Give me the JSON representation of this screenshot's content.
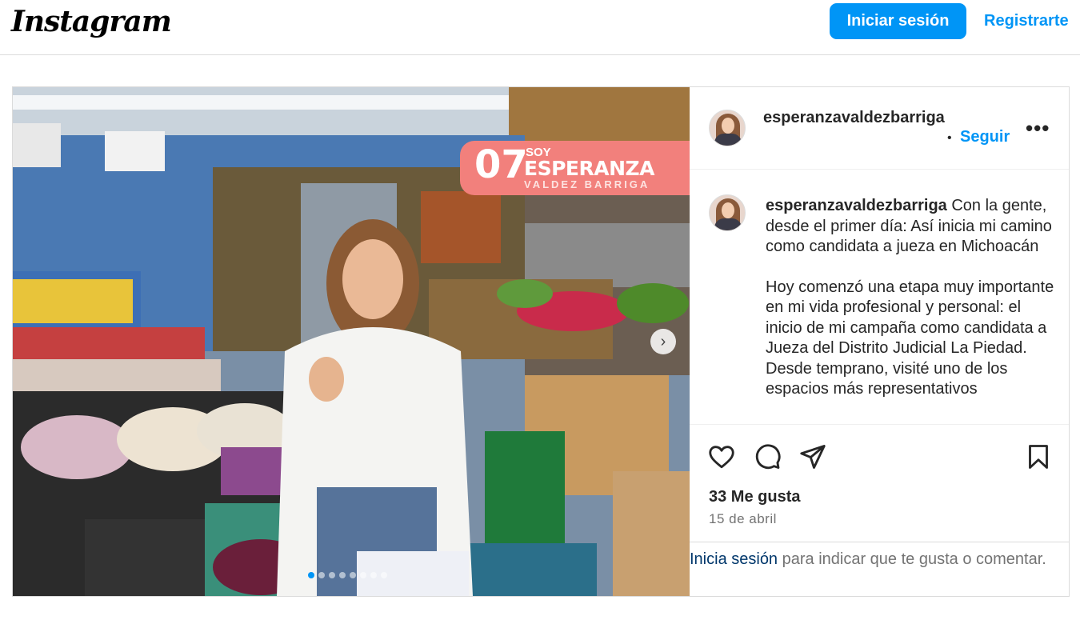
{
  "header": {
    "logo": "Instagram",
    "login_button": "Iniciar sesión",
    "register_link": "Registrarte"
  },
  "post": {
    "username": "esperanzavaldezbarriga",
    "follow_label": "Seguir",
    "more_label": "•••",
    "separator": "•",
    "image_overlay": {
      "number": "07",
      "soy": "SOY",
      "name": "ESPERANZA",
      "surname": "VALDEZ BARRIGA"
    },
    "carousel": {
      "slides": 8,
      "active_index": 0,
      "next_label": "›"
    },
    "caption": {
      "paragraph1": "Con la gente, desde el primer día: Así inicia mi camino como candidata a jueza en Michoacán",
      "paragraph2": "Hoy comenzó una etapa muy importante en mi vida profesional y personal: el inicio de mi campaña como candidata a Jueza del Distrito Judicial La Piedad. Desde temprano, visité uno de los espacios más representativos"
    },
    "likes": "33 Me gusta",
    "date": "15 de abril",
    "login_prompt": {
      "link": "Inicia sesión",
      "rest": " para indicar que te gusta o comentar."
    }
  },
  "colors": {
    "accent": "#0095f6",
    "badge": "#f2807c",
    "link_dark": "#00376b",
    "muted": "#737373"
  },
  "icons": [
    "heart-icon",
    "comment-icon",
    "share-icon",
    "bookmark-icon",
    "chevron-right-icon"
  ]
}
